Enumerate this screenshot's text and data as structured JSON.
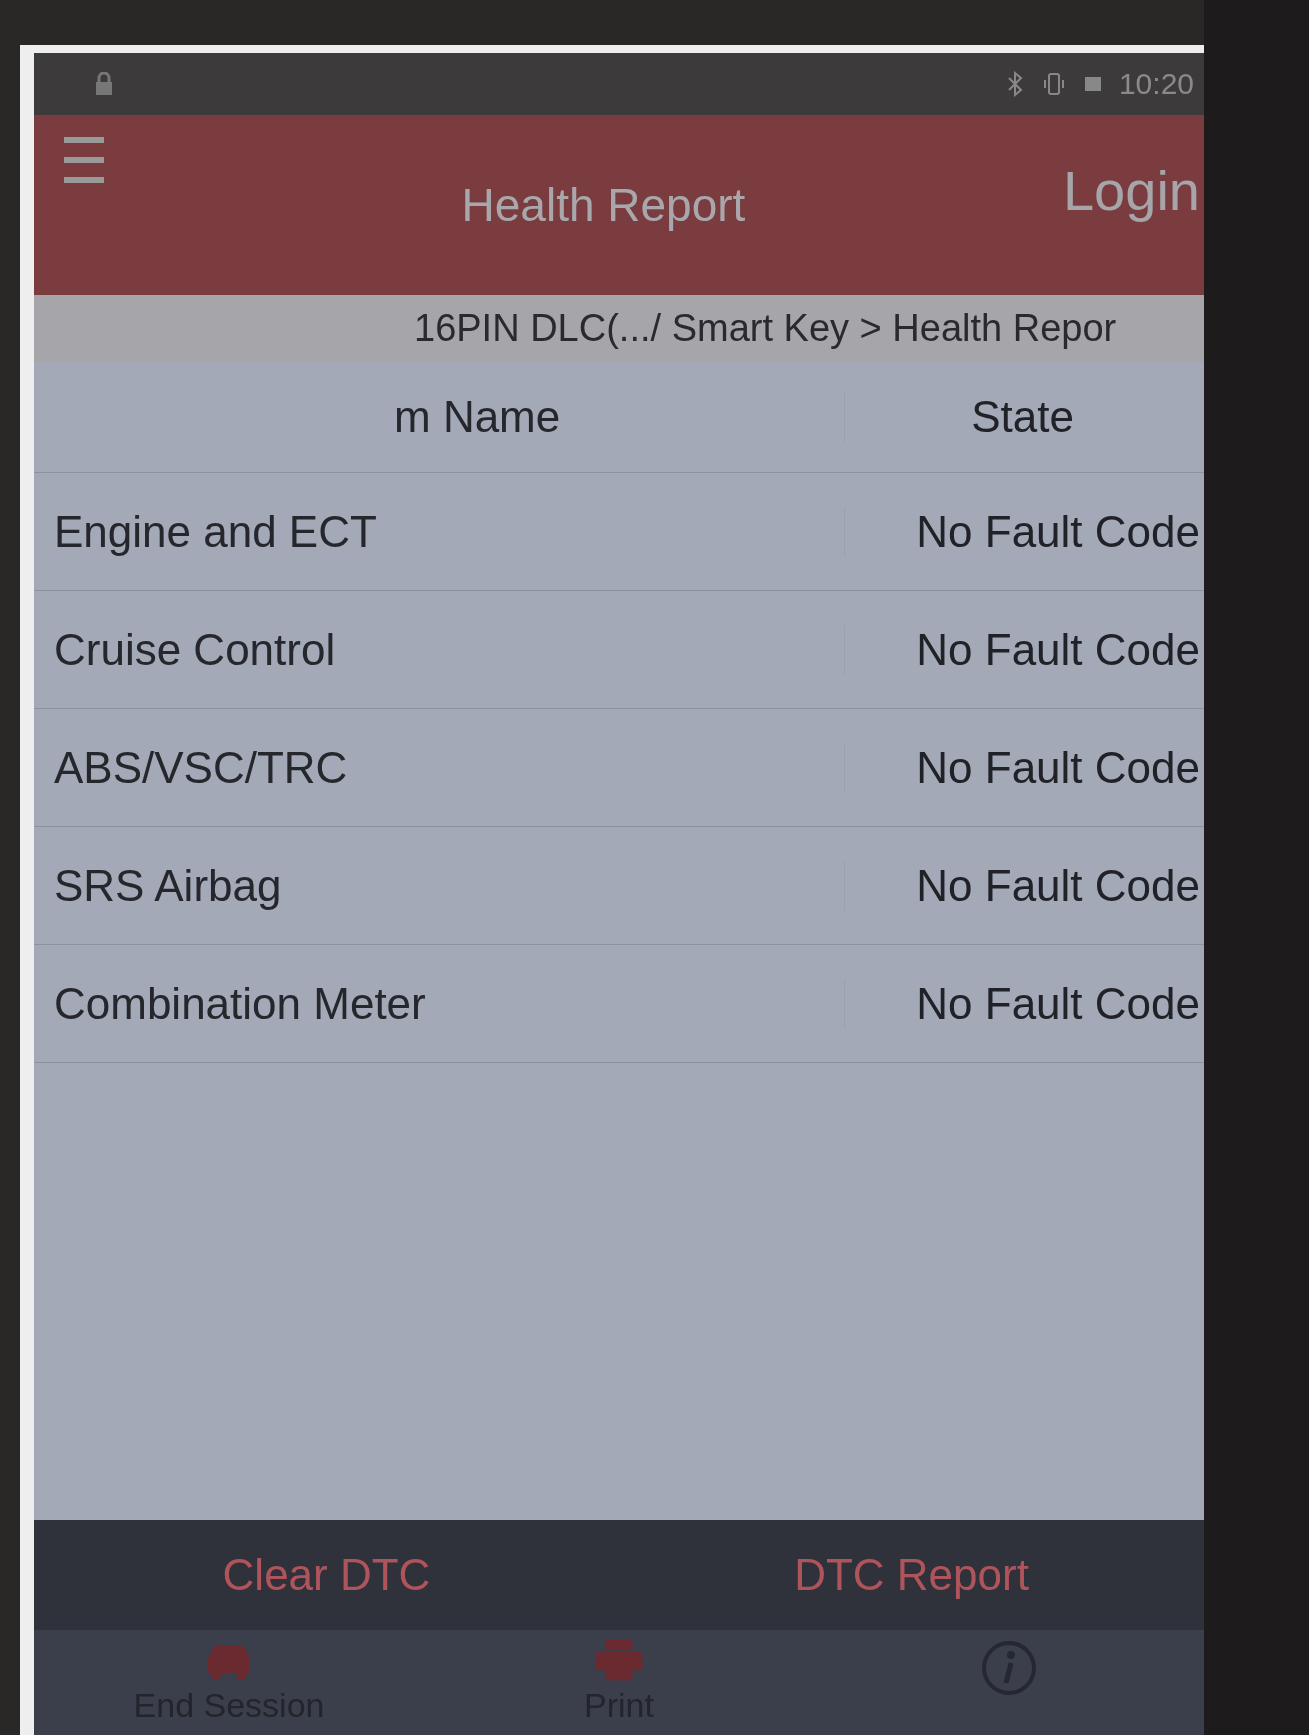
{
  "status_bar": {
    "time": "10:20"
  },
  "header": {
    "title": "Health Report",
    "login": "Login"
  },
  "breadcrumb": "16PIN DLC(.../ Smart Key > Health Repor",
  "table": {
    "columns": [
      "m Name",
      "State"
    ],
    "rows": [
      {
        "system": "Engine and ECT",
        "state": "No Fault Code"
      },
      {
        "system": "Cruise Control",
        "state": "No Fault Code"
      },
      {
        "system": "ABS/VSC/TRC",
        "state": "No Fault Code"
      },
      {
        "system": "SRS Airbag",
        "state": "No Fault Code"
      },
      {
        "system": "Combination Meter",
        "state": "No Fault Code"
      }
    ]
  },
  "actions": [
    "Clear DTC",
    "DTC Report"
  ],
  "nav": [
    {
      "kind": "car",
      "label": "End Session"
    },
    {
      "kind": "printer",
      "label": "Print"
    },
    {
      "kind": "info"
    }
  ]
}
